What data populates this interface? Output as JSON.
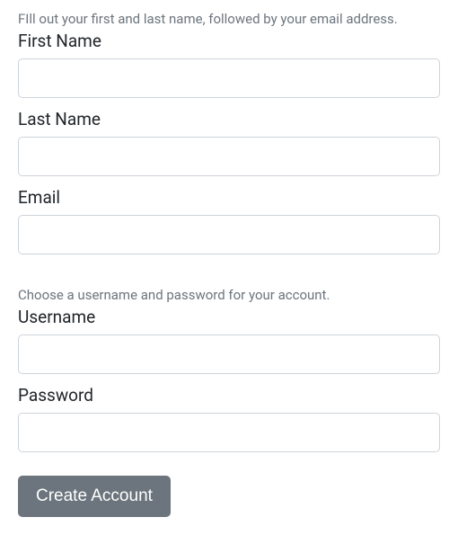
{
  "section1": {
    "help": "FIll out your first and last name, followed by your email address.",
    "first_name_label": "First Name",
    "first_name_value": "",
    "last_name_label": "Last Name",
    "last_name_value": "",
    "email_label": "Email",
    "email_value": ""
  },
  "section2": {
    "help": "Choose a username and password for your account.",
    "username_label": "Username",
    "username_value": "",
    "password_label": "Password",
    "password_value": ""
  },
  "submit_label": "Create Account"
}
